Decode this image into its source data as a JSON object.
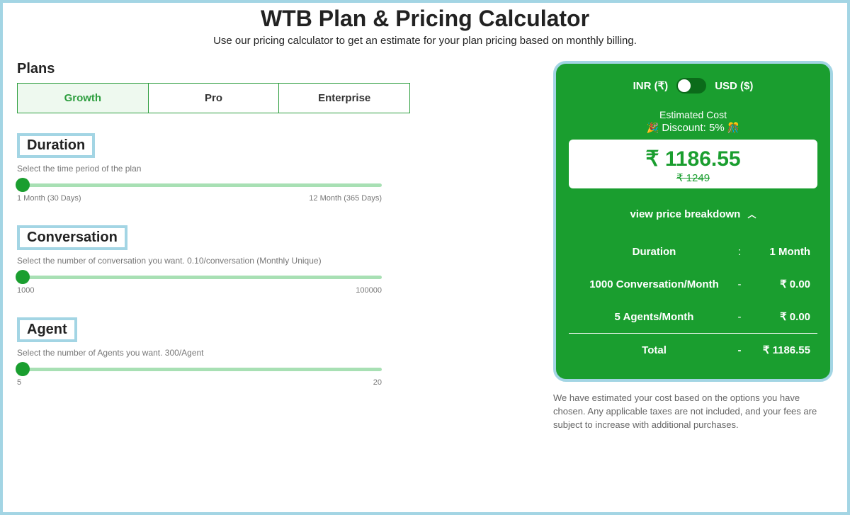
{
  "header": {
    "title": "WTB Plan & Pricing Calculator",
    "subtitle": "Use our pricing calculator to get an estimate for your plan pricing based on monthly billing."
  },
  "plans": {
    "label": "Plans",
    "tabs": [
      "Growth",
      "Pro",
      "Enterprise"
    ],
    "active_index": 0
  },
  "duration": {
    "title": "Duration",
    "desc": "Select the time period of the plan",
    "min_label": "1 Month (30 Days)",
    "max_label": "12 Month (365 Days)"
  },
  "conversation": {
    "title": "Conversation",
    "desc": "Select the number of conversation you want. 0.10/conversation (Monthly Unique)",
    "min_label": "1000",
    "max_label": "100000"
  },
  "agent": {
    "title": "Agent",
    "desc": "Select the number of Agents you want. 300/Agent",
    "min_label": "5",
    "max_label": "20"
  },
  "currency": {
    "inr_label": "INR (₹)",
    "usd_label": "USD ($)",
    "active": "INR"
  },
  "estimate": {
    "label": "Estimated Cost",
    "discount_text": "Discount: 5%",
    "price": "₹ 1186.55",
    "original_price": "₹ 1249"
  },
  "breakdown": {
    "toggle_label": "view price breakdown",
    "rows": [
      {
        "label": "Duration",
        "sep": ":",
        "value": "1 Month"
      },
      {
        "label": "1000 Conversation/Month",
        "sep": "-",
        "value": "₹ 0.00"
      },
      {
        "label": "5 Agents/Month",
        "sep": "-",
        "value": "₹ 0.00"
      }
    ],
    "total": {
      "label": "Total",
      "sep": "-",
      "value": "₹ 1186.55"
    }
  },
  "disclaimer": "We have estimated your cost based on the options you have chosen. Any applicable taxes are not included, and your fees are subject to increase with additional purchases."
}
